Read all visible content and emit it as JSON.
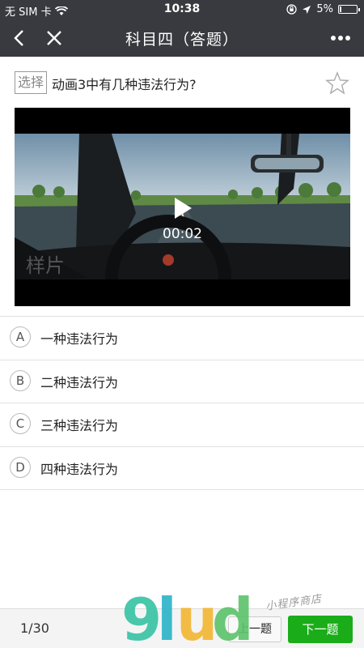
{
  "status_bar": {
    "carrier": "无 SIM 卡",
    "time": "10:38",
    "battery_percent": "5%",
    "battery_level": 0.05
  },
  "nav": {
    "title": "科目四（答题）",
    "back_icon": "chevron-left-icon",
    "close_icon": "close-icon",
    "more_icon": "more-dots-icon"
  },
  "question": {
    "type_tag": "选择",
    "text": "动画3中有几种违法行为?",
    "favorite_icon": "star-outline-icon"
  },
  "video": {
    "time": "00:02",
    "watermark": "样片"
  },
  "options": [
    {
      "letter": "A",
      "text": "一种违法行为"
    },
    {
      "letter": "B",
      "text": "二种违法行为"
    },
    {
      "letter": "C",
      "text": "三种违法行为"
    },
    {
      "letter": "D",
      "text": "四种违法行为"
    }
  ],
  "footer": {
    "counter": "1/30",
    "prev_label": "上一题",
    "next_label": "下一题"
  },
  "overlay": {
    "logo_text": "9lud",
    "logo_sub": "小程序商店",
    "logo_colors": [
      "#36c3a4",
      "#2bb3c8",
      "#f2b632",
      "#5bc36b"
    ]
  },
  "colors": {
    "nav_bg": "#393a3f",
    "accent_green": "#1aad19"
  }
}
